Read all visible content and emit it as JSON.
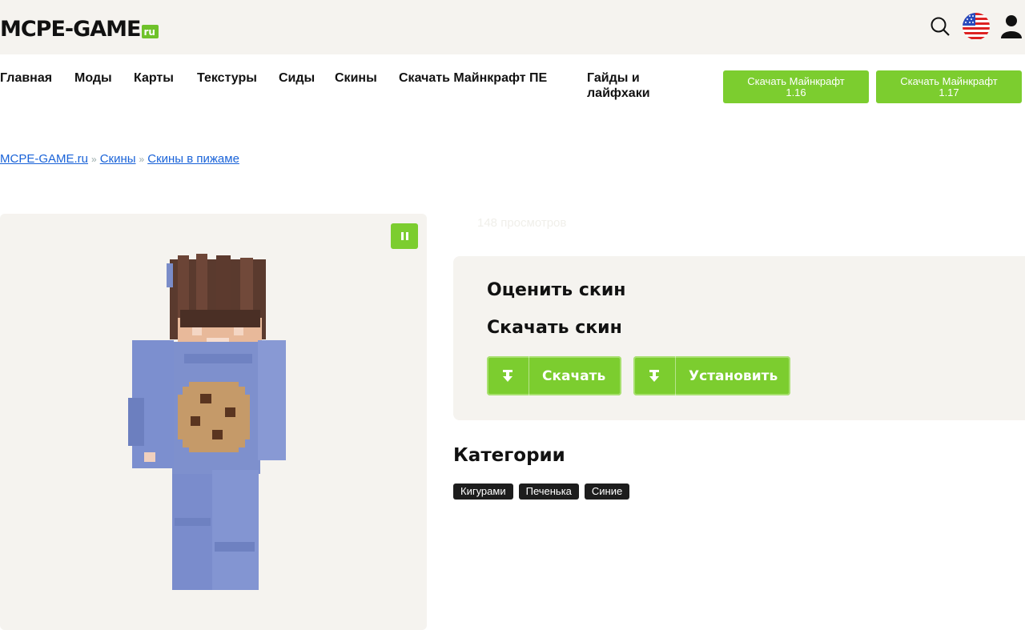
{
  "header": {
    "logo_main": "MCPE-GAME",
    "logo_ru": "ru"
  },
  "nav": {
    "items": [
      "Главная",
      "Моды",
      "Карты",
      "Текстуры",
      "Сиды",
      "Скины",
      "Скачать Майнкрафт ПЕ",
      "Гайды и лайфхаки"
    ],
    "download_116": {
      "line1": "Скачать Майнкрафт",
      "line2": "1.16"
    },
    "download_117": {
      "line1": "Скачать Майнкрафт",
      "line2": "1.17"
    }
  },
  "breadcrumb": [
    "MCPE-GAME.ru",
    "Скины",
    "Скины в пижаме"
  ],
  "breadcrumb_sep": "»",
  "views": "148 просмотров",
  "rate_title": "Оценить скин",
  "download_title": "Скачать скин",
  "buttons": {
    "download": "Скачать",
    "install": "Установить"
  },
  "categories_title": "Категории",
  "tags": [
    "Кигурами",
    "Печенька",
    "Синие"
  ],
  "colors": {
    "accent": "#7ccd2f",
    "panel": "#f5f3ef",
    "link": "#1a63d8"
  },
  "icons": [
    "search-icon",
    "us-flag-icon",
    "user-icon",
    "pause-icon",
    "download-icon"
  ]
}
